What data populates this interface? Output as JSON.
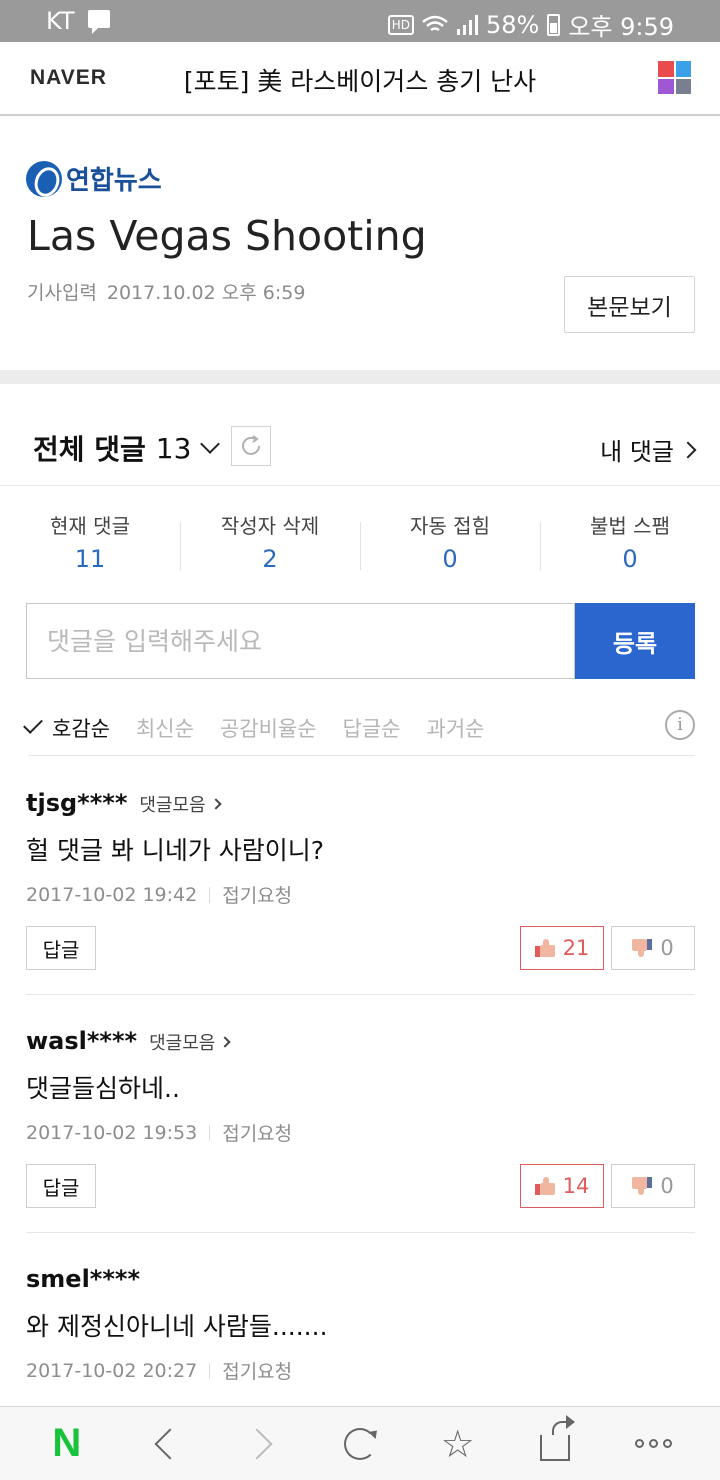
{
  "status_bar": {
    "carrier": "KT",
    "hd": "HD",
    "battery": "58%",
    "time": "오후 9:59"
  },
  "header": {
    "logo": "NAVER",
    "title": "[포토] 美 라스베이거스 총기 난사"
  },
  "article": {
    "press": "연합뉴스",
    "headline": "Las Vegas Shooting",
    "meta_label": "기사입력",
    "meta_date": "2017.10.02 오후 6:59",
    "view_button": "본문보기"
  },
  "comments_header": {
    "title": "전체 댓글",
    "count": "13",
    "my_comments": "내 댓글"
  },
  "stats": [
    {
      "label": "현재 댓글",
      "value": "11"
    },
    {
      "label": "작성자 삭제",
      "value": "2"
    },
    {
      "label": "자동 접힘",
      "value": "0"
    },
    {
      "label": "불법 스팸",
      "value": "0"
    }
  ],
  "input": {
    "placeholder": "댓글을 입력해주세요",
    "submit": "등록"
  },
  "sort": {
    "options": [
      "호감순",
      "최신순",
      "공감비율순",
      "답글순",
      "과거순"
    ]
  },
  "comments": [
    {
      "user": "tjsg****",
      "collection": "댓글모음",
      "text": "헐 댓글 봐 니네가 사람이니?",
      "date": "2017-10-02 19:42",
      "fold": "접기요청",
      "reply": "답글",
      "likes": "21",
      "dislikes": "0"
    },
    {
      "user": "wasl****",
      "collection": "댓글모음",
      "text": "댓글들심하네..",
      "date": "2017-10-02 19:53",
      "fold": "접기요청",
      "reply": "답글",
      "likes": "14",
      "dislikes": "0"
    },
    {
      "user": "smel****",
      "text": "와 제정신아니네 사람들.......",
      "date": "2017-10-02 20:27",
      "fold": "접기요청"
    }
  ],
  "colors": {
    "accent": "#2b66cf",
    "stat_value": "#2a6bbf",
    "like": "#e05c5c",
    "naver_green": "#19c23b"
  },
  "icons": [
    "message-icon",
    "wifi-icon",
    "signal-icon",
    "battery-icon",
    "app-grid-icon",
    "yonhap-logo-icon",
    "chevron-down-icon",
    "refresh-icon",
    "chevron-right-icon",
    "check-icon",
    "info-icon",
    "thumbs-up-icon",
    "thumbs-down-icon",
    "naver-home-icon",
    "back-arrow-icon",
    "forward-arrow-icon",
    "reload-icon",
    "star-icon",
    "share-icon",
    "more-icon"
  ]
}
